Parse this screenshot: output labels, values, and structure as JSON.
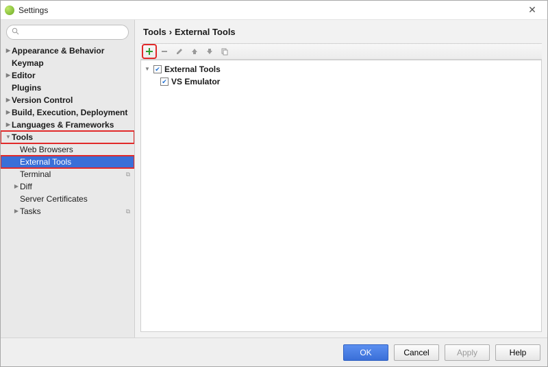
{
  "window": {
    "title": "Settings"
  },
  "search": {
    "placeholder": "",
    "value": ""
  },
  "sidebar": {
    "items": [
      {
        "label": "Appearance & Behavior",
        "level": 1,
        "expandable": true,
        "expanded": false
      },
      {
        "label": "Keymap",
        "level": 1,
        "expandable": false
      },
      {
        "label": "Editor",
        "level": 1,
        "expandable": true,
        "expanded": false
      },
      {
        "label": "Plugins",
        "level": 1,
        "expandable": false
      },
      {
        "label": "Version Control",
        "level": 1,
        "expandable": true,
        "expanded": false
      },
      {
        "label": "Build, Execution, Deployment",
        "level": 1,
        "expandable": true,
        "expanded": false
      },
      {
        "label": "Languages & Frameworks",
        "level": 1,
        "expandable": true,
        "expanded": false
      },
      {
        "label": "Tools",
        "level": 1,
        "expandable": true,
        "expanded": true,
        "highlight": true
      },
      {
        "label": "Web Browsers",
        "level": 2,
        "expandable": false
      },
      {
        "label": "External Tools",
        "level": 2,
        "expandable": false,
        "selected": true,
        "highlight": true
      },
      {
        "label": "Terminal",
        "level": 2,
        "expandable": false,
        "project_badge": true
      },
      {
        "label": "Diff",
        "level": 2,
        "expandable": true,
        "expanded": false
      },
      {
        "label": "Server Certificates",
        "level": 2,
        "expandable": false
      },
      {
        "label": "Tasks",
        "level": 2,
        "expandable": true,
        "expanded": false,
        "project_badge": true
      }
    ]
  },
  "breadcrumb": {
    "root": "Tools",
    "sep": "›",
    "leaf": "External Tools"
  },
  "toolbar": {
    "add_tooltip": "Add",
    "remove_tooltip": "Remove",
    "edit_tooltip": "Edit",
    "up_tooltip": "Up",
    "down_tooltip": "Down",
    "copy_tooltip": "Copy"
  },
  "list": {
    "group": {
      "label": "External Tools",
      "checked": true
    },
    "items": [
      {
        "label": "VS Emulator",
        "checked": true
      }
    ]
  },
  "footer": {
    "ok": "OK",
    "cancel": "Cancel",
    "apply": "Apply",
    "help": "Help"
  }
}
